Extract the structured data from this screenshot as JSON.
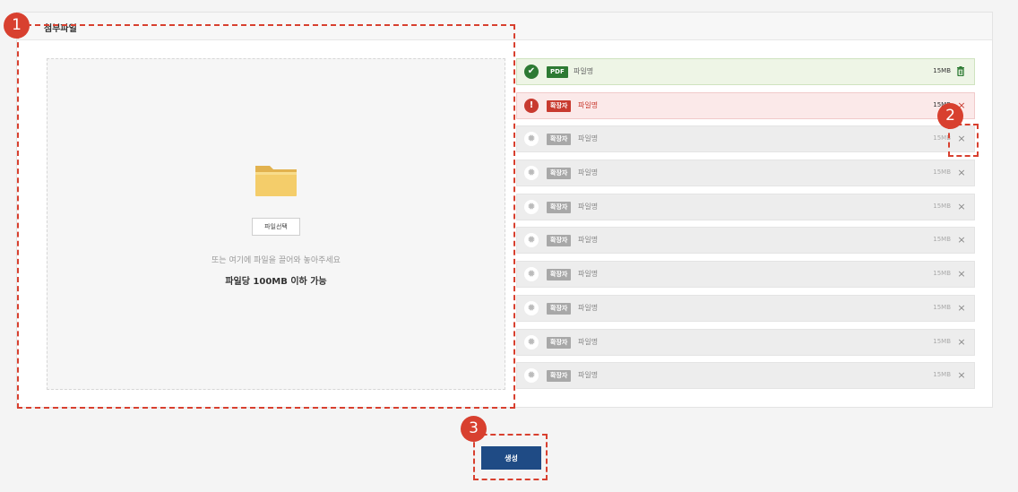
{
  "panel": {
    "title": "첨부파일"
  },
  "dropzone": {
    "select_button": "파일선택",
    "drop_hint": "또는 여기에 파일을 끌어와 놓아주세요",
    "size_limit": "파일당 100MB 이하 가능",
    "icon": "folder-icon"
  },
  "files": [
    {
      "status": "success",
      "ext": "PDF",
      "name": "파일명",
      "size": "15MB",
      "action": "trash-icon"
    },
    {
      "status": "error",
      "ext": "확장자",
      "name": "파일명",
      "size": "15MB",
      "action": "close-icon"
    },
    {
      "status": "loading",
      "ext": "확장자",
      "name": "파일명",
      "size": "15MB",
      "action": "close-icon"
    },
    {
      "status": "loading",
      "ext": "확장자",
      "name": "파일명",
      "size": "15MB",
      "action": "close-icon"
    },
    {
      "status": "loading",
      "ext": "확장자",
      "name": "파일명",
      "size": "15MB",
      "action": "close-icon"
    },
    {
      "status": "loading",
      "ext": "확장자",
      "name": "파일명",
      "size": "15MB",
      "action": "close-icon"
    },
    {
      "status": "loading",
      "ext": "확장자",
      "name": "파일명",
      "size": "15MB",
      "action": "close-icon"
    },
    {
      "status": "loading",
      "ext": "확장자",
      "name": "파일명",
      "size": "15MB",
      "action": "close-icon"
    },
    {
      "status": "loading",
      "ext": "확장자",
      "name": "파일명",
      "size": "15MB",
      "action": "close-icon"
    },
    {
      "status": "loading",
      "ext": "확장자",
      "name": "파일명",
      "size": "15MB",
      "action": "close-icon"
    }
  ],
  "create_button": "생성",
  "callouts": [
    "1",
    "2",
    "3"
  ],
  "colors": {
    "success": "#2d7a33",
    "error": "#c83a2f",
    "primary": "#1f4b85",
    "callout": "#d8402f"
  }
}
